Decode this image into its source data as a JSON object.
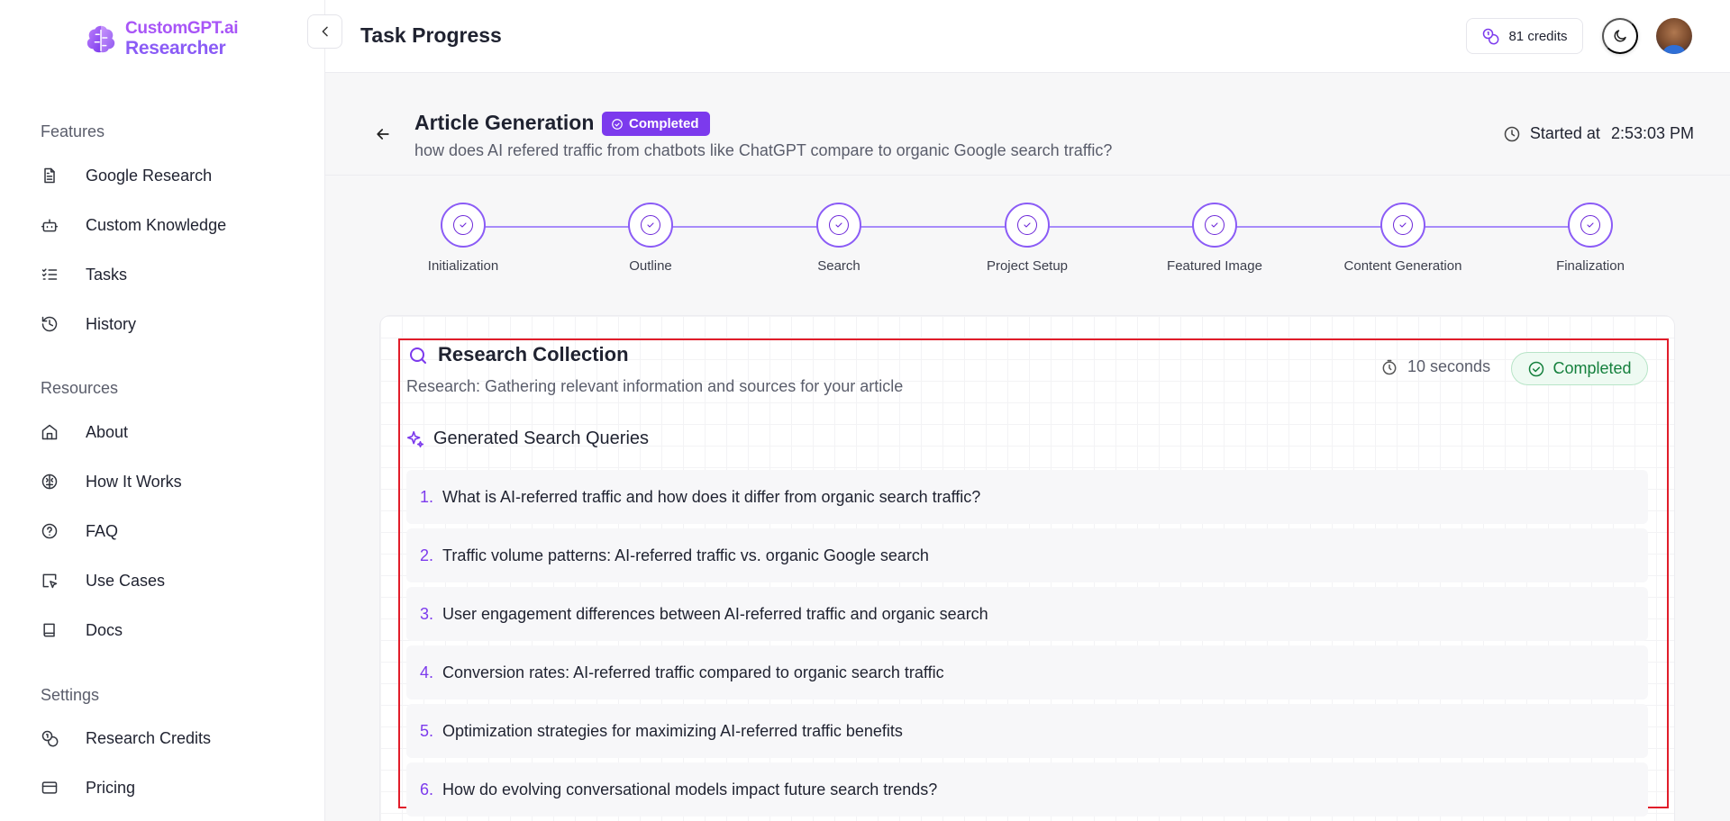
{
  "brand": {
    "line1": "CustomGPT.ai",
    "line2": "Researcher"
  },
  "sidebar": {
    "sections": [
      {
        "label": "Features",
        "items": [
          {
            "label": "Google Research",
            "icon": "document-icon"
          },
          {
            "label": "Custom Knowledge",
            "icon": "bot-icon"
          },
          {
            "label": "Tasks",
            "icon": "list-check-icon"
          },
          {
            "label": "History",
            "icon": "history-icon"
          }
        ]
      },
      {
        "label": "Resources",
        "items": [
          {
            "label": "About",
            "icon": "home-icon"
          },
          {
            "label": "How It Works",
            "icon": "brain-icon"
          },
          {
            "label": "FAQ",
            "icon": "help-circle-icon"
          },
          {
            "label": "Use Cases",
            "icon": "cursor-square-icon"
          },
          {
            "label": "Docs",
            "icon": "book-icon"
          }
        ]
      },
      {
        "label": "Settings",
        "items": [
          {
            "label": "Research Credits",
            "icon": "coins-icon"
          },
          {
            "label": "Pricing",
            "icon": "credit-card-icon"
          }
        ]
      }
    ]
  },
  "topbar": {
    "title": "Task Progress",
    "credits": "81 credits"
  },
  "task": {
    "title": "Article Generation",
    "status": "Completed",
    "query": "how does AI refered traffic from chatbots like ChatGPT compare to organic Google search traffic?",
    "started_label": "Started at",
    "started_time": "2:53:03 PM"
  },
  "steps": [
    "Initialization",
    "Outline",
    "Search",
    "Project Setup",
    "Featured Image",
    "Content Generation",
    "Finalization"
  ],
  "research": {
    "title": "Research Collection",
    "subtitle": "Research: Gathering relevant information and sources for your article",
    "duration": "10 seconds",
    "status": "Completed",
    "queries_title": "Generated Search Queries",
    "queries": [
      {
        "num": "1.",
        "text": "What is AI-referred traffic and how does it differ from organic search traffic?"
      },
      {
        "num": "2.",
        "text": "Traffic volume patterns: AI-referred traffic vs. organic Google search"
      },
      {
        "num": "3.",
        "text": "User engagement differences between AI-referred traffic and organic search"
      },
      {
        "num": "4.",
        "text": "Conversion rates: AI-referred traffic compared to organic search traffic"
      },
      {
        "num": "5.",
        "text": "Optimization strategies for maximizing AI-referred traffic benefits"
      },
      {
        "num": "6.",
        "text": "How do evolving conversational models impact future search trends?"
      }
    ]
  },
  "colors": {
    "accent": "#7c3aed",
    "success": "#15803d",
    "highlight_border": "#e11d2a"
  }
}
